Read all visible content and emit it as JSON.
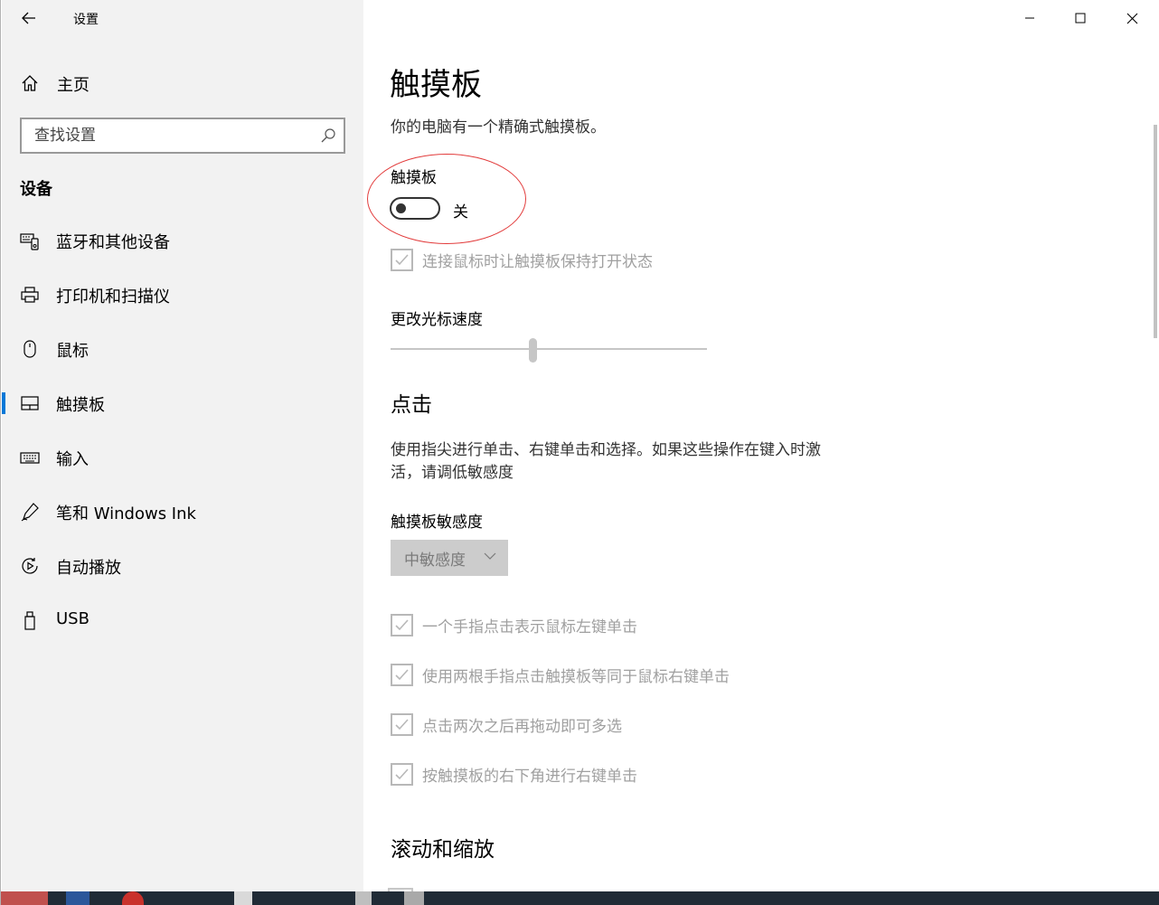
{
  "window": {
    "title": "设置"
  },
  "sidebar": {
    "home_label": "主页",
    "search_placeholder": "查找设置",
    "section_title": "设备",
    "items": [
      {
        "label": "蓝牙和其他设备",
        "icon": "bluetooth-devices-icon"
      },
      {
        "label": "打印机和扫描仪",
        "icon": "printer-icon"
      },
      {
        "label": "鼠标",
        "icon": "mouse-icon"
      },
      {
        "label": "触摸板",
        "icon": "touchpad-icon",
        "active": true
      },
      {
        "label": "输入",
        "icon": "keyboard-icon"
      },
      {
        "label": "笔和 Windows Ink",
        "icon": "pen-icon"
      },
      {
        "label": "自动播放",
        "icon": "autoplay-icon"
      },
      {
        "label": "USB",
        "icon": "usb-icon"
      }
    ]
  },
  "main": {
    "title": "触摸板",
    "description": "你的电脑有一个精确式触摸板。",
    "touchpad_toggle": {
      "label": "触摸板",
      "state_text": "关",
      "on": false
    },
    "keep_on_with_mouse": {
      "label": "连接鼠标时让触摸板保持打开状态",
      "checked": true,
      "disabled": true
    },
    "cursor_speed": {
      "label": "更改光标速度",
      "value_fraction": 0.45
    },
    "taps": {
      "heading": "点击",
      "description_line1": "使用指尖进行单击、右键单击和选择。如果这些操作在键入时激",
      "description_line2": "活，请调低敏感度",
      "sensitivity_label": "触摸板敏感度",
      "sensitivity_value": "中敏感度",
      "options": [
        {
          "label": "一个手指点击表示鼠标左键单击",
          "checked": true
        },
        {
          "label": "使用两根手指点击触摸板等同于鼠标右键单击",
          "checked": true
        },
        {
          "label": "点击两次之后再拖动即可多选",
          "checked": true
        },
        {
          "label": "按触摸板的右下角进行右键单击",
          "checked": true
        }
      ]
    },
    "scroll_zoom": {
      "heading": "滚动和缩放"
    }
  },
  "colors": {
    "accent": "#0078d7",
    "annotation": "#e23b3b",
    "sidebar_bg": "#f2f2f2",
    "disabled_text": "#a0a0a0"
  }
}
